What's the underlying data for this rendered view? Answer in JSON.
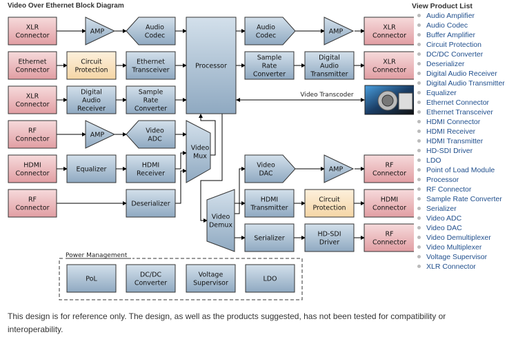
{
  "title": "Video Over Ethernet Block Diagram",
  "product_list": {
    "title": "View Product List",
    "items": [
      "Audio Amplifier",
      "Audio Codec",
      "Buffer Amplifier",
      "Circuit Protection",
      "DC/DC Converter",
      "Deserializer",
      "Digital Audio Receiver",
      "Digital Audio Transmitter",
      "Equalizer",
      "Ethernet Connector",
      "Ethernet Transceiver",
      "HDMI Connector",
      "HDMI Receiver",
      "HDMI Transmitter",
      "HD-SDI Driver",
      "LDO",
      "Point of Load Module",
      "Processor",
      "RF Connector",
      "Sample Rate Converter",
      "Serializer",
      "Video ADC",
      "Video DAC",
      "Video Demultiplexer",
      "Video Multiplexer",
      "Voltage Supervisor",
      "XLR Connector"
    ]
  },
  "colors": {
    "connector": "#e8a8ac",
    "protection": "#f8ddb0",
    "ic": "#a9bfd3",
    "link": "#1f4e8c"
  },
  "blocks": {
    "xlr_in1": [
      "XLR",
      "Connector"
    ],
    "amp1": [
      "AMP"
    ],
    "audio_codec_in": [
      "Audio",
      "Codec"
    ],
    "eth_conn": [
      "Ethernet",
      "Connector"
    ],
    "circ_prot1": [
      "Circuit",
      "Protection"
    ],
    "eth_xcvr": [
      "Ethernet",
      "Transceiver"
    ],
    "xlr_in2": [
      "XLR",
      "Connector"
    ],
    "dar": [
      "Digital",
      "Audio",
      "Receiver"
    ],
    "src_in": [
      "Sample",
      "Rate",
      "Converter"
    ],
    "rf_in1": [
      "RF",
      "Connector"
    ],
    "amp2": [
      "AMP"
    ],
    "vadc": [
      "Video",
      "ADC"
    ],
    "hdmi_in": [
      "HDMI",
      "Connector"
    ],
    "eq": [
      "Equalizer"
    ],
    "hdmi_rx": [
      "HDMI",
      "Receiver"
    ],
    "rf_in2": [
      "RF",
      "Connector"
    ],
    "deser": [
      "Deserializer"
    ],
    "processor": [
      "Processor"
    ],
    "vmux": [
      "Video",
      "Mux"
    ],
    "vdemux": [
      "Video",
      "Demux"
    ],
    "audio_codec_out": [
      "Audio",
      "Codec"
    ],
    "amp3": [
      "AMP"
    ],
    "xlr_out1": [
      "XLR",
      "Connector"
    ],
    "src_out": [
      "Sample",
      "Rate",
      "Converter"
    ],
    "dat": [
      "Digital",
      "Audio",
      "Transmitter"
    ],
    "xlr_out2": [
      "XLR",
      "Connector"
    ],
    "transcoder_label": [
      "Video Transcoder"
    ],
    "vdac": [
      "Video",
      "DAC"
    ],
    "amp4": [
      "AMP"
    ],
    "rf_out1": [
      "RF",
      "Connector"
    ],
    "hdmi_tx": [
      "HDMI",
      "Transmitter"
    ],
    "circ_prot2": [
      "Circuit",
      "Protection"
    ],
    "hdmi_out": [
      "HDMI",
      "Connector"
    ],
    "ser": [
      "Serializer"
    ],
    "hdsdi": [
      "HD-SDI",
      "Driver"
    ],
    "rf_out2": [
      "RF",
      "Connector"
    ],
    "power_label": [
      "Power Management"
    ],
    "pol": [
      "PoL"
    ],
    "dcdc": [
      "DC/DC",
      "Converter"
    ],
    "vsup": [
      "Voltage",
      "Supervisor"
    ],
    "ldo": [
      "LDO"
    ]
  },
  "note": "This design is for reference only. The design, as well as the products suggested, has not been tested for compatibility or interoperability."
}
